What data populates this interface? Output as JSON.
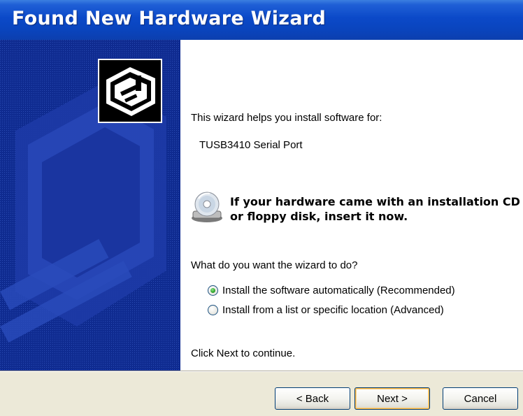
{
  "window": {
    "title": "Found New Hardware Wizard"
  },
  "content": {
    "intro": "This wizard helps you install software for:",
    "device_name": "TUSB3410 Serial Port",
    "cd_message_line1": "If your hardware came with an installation CD",
    "cd_message_line2": "or floppy disk, insert it now.",
    "question": "What do you want the wizard to do?",
    "options": [
      {
        "label": "Install the software automatically (Recommended)",
        "selected": true
      },
      {
        "label": "Install from a list or specific location (Advanced)",
        "selected": false
      }
    ],
    "continue_text": "Click Next to continue."
  },
  "buttons": {
    "back": "< Back",
    "next": "Next >",
    "cancel": "Cancel"
  },
  "icons": {
    "wizard": "hardware-wizard-icon",
    "cd": "cd-disk-icon"
  },
  "colors": {
    "titlebar": "#0a44bd",
    "sidebar": "#0e2a8c",
    "footer": "#ece9d8"
  }
}
